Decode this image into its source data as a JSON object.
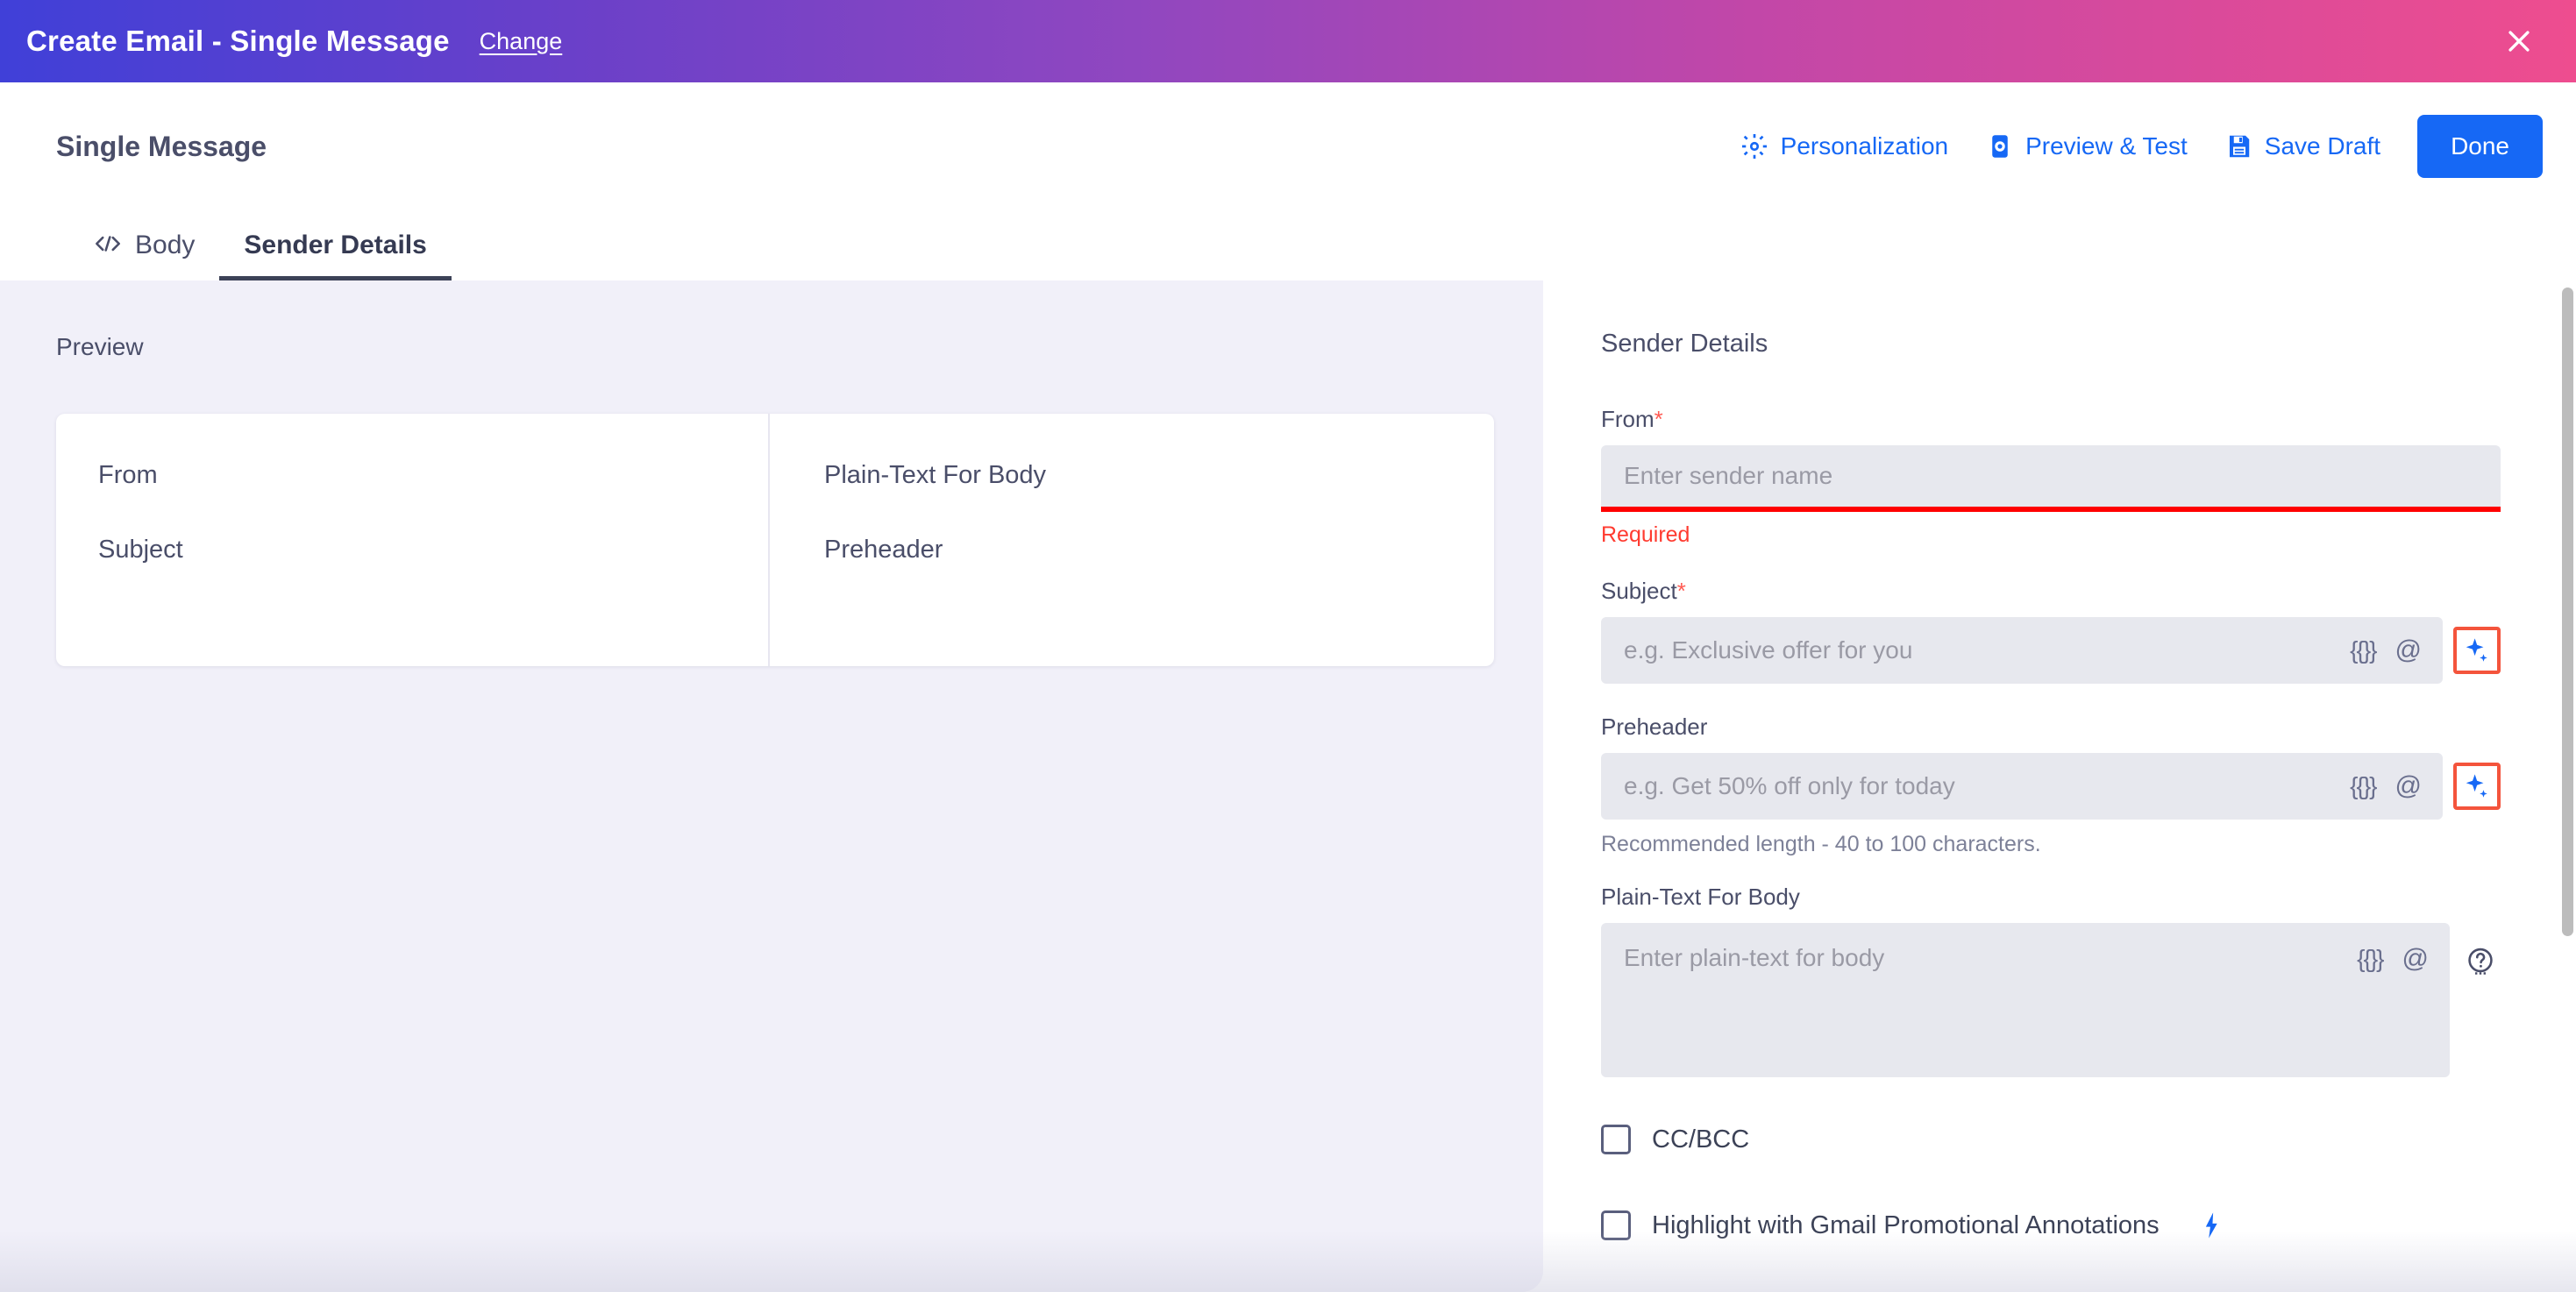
{
  "titlebar": {
    "title": "Create Email - Single Message",
    "change_link": "Change",
    "close_icon": "close-icon",
    "gradient_from": "#4040d8",
    "gradient_to": "#ee4d8f"
  },
  "toolbar": {
    "page_title": "Single Message",
    "actions": [
      {
        "label": "Personalization",
        "icon": "gear-icon"
      },
      {
        "label": "Preview & Test",
        "icon": "mobile-preview-icon"
      },
      {
        "label": "Save Draft",
        "icon": "save-disk-icon"
      }
    ],
    "done_label": "Done",
    "accent_color": "#1668f5"
  },
  "tabs": [
    {
      "label": "Body",
      "icon": "code-icon",
      "active": false
    },
    {
      "label": "Sender Details",
      "icon": "",
      "active": true
    }
  ],
  "preview": {
    "heading": "Preview",
    "left_rows": [
      "From",
      "Subject"
    ],
    "right_rows": [
      "Plain-Text For Body",
      "Preheader"
    ]
  },
  "sender_details": {
    "heading": "Sender Details",
    "from": {
      "label": "From",
      "required_marker": "*",
      "placeholder": "Enter sender name",
      "value": "",
      "error": "Required",
      "error_color": "#ff3b30"
    },
    "subject": {
      "label": "Subject",
      "required_marker": "*",
      "placeholder": "e.g. Exclusive offer for you",
      "value": "",
      "merge_tag_icon": "{{}}",
      "at_icon": "@",
      "ai_icon": "ai-sparkle-icon",
      "ai_highlight_color": "#f4543c"
    },
    "preheader": {
      "label": "Preheader",
      "placeholder": "e.g. Get 50% off only for today",
      "value": "",
      "hint": "Recommended length - 40 to 100 characters.",
      "merge_tag_icon": "{{}}",
      "at_icon": "@",
      "ai_icon": "ai-sparkle-icon",
      "ai_highlight_color": "#f4543c"
    },
    "plain_text_body": {
      "label": "Plain-Text For Body",
      "placeholder": "Enter plain-text for body",
      "value": "",
      "merge_tag_icon": "{{}}",
      "at_icon": "@",
      "help_icon": "help-question-icon"
    },
    "checkboxes": [
      {
        "label": "CC/BCC",
        "checked": false,
        "badge_icon": ""
      },
      {
        "label": "Highlight with Gmail Promotional Annotations",
        "checked": false,
        "badge_icon": "lightning-bolt-icon"
      }
    ]
  }
}
